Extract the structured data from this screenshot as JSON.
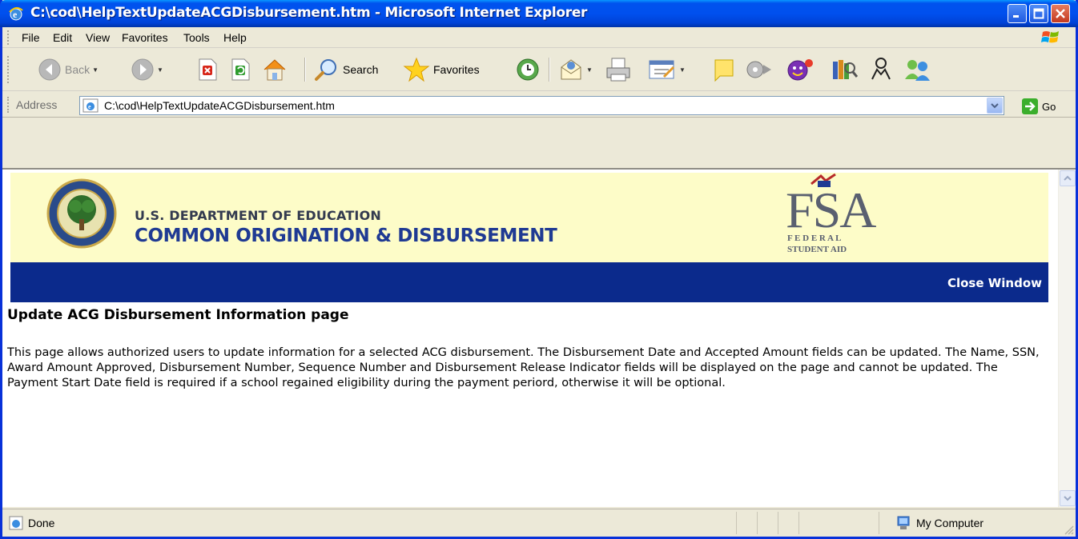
{
  "window": {
    "title": "C:\\cod\\HelpTextUpdateACGDisbursement.htm - Microsoft Internet Explorer"
  },
  "menu": [
    "File",
    "Edit",
    "View",
    "Favorites",
    "Tools",
    "Help"
  ],
  "toolbar": {
    "back_label": "Back",
    "search_label": "Search",
    "favorites_label": "Favorites"
  },
  "address": {
    "label": "Address",
    "value": "C:\\cod\\HelpTextUpdateACGDisbursement.htm",
    "go_label": "Go"
  },
  "page": {
    "dept_line1": "U.S. DEPARTMENT OF EDUCATION",
    "dept_line2": "COMMON ORIGINATION & DISBURSEMENT",
    "fsa_letters": "FSA",
    "fsa_federal": "F E D E R A L",
    "fsa_student_aid": "STUDENT AID",
    "close_window": "Close Window",
    "heading": "Update ACG Disbursement Information page",
    "body": "This page allows authorized users to update information for a selected ACG disbursement. The Disbursement Date and Accepted Amount fields can be updated. The Name, SSN, Award Amount Approved, Disbursement Number, Sequence Number and Disbursement Release Indicator fields will be displayed on the page and cannot be updated. The Payment Start Date field is required if a school regained eligibility during the payment periord, otherwise it will be optional."
  },
  "status": {
    "text": "Done",
    "zone": "My Computer"
  },
  "colors": {
    "titlebar": "#0050ee",
    "banner_bg": "#fdfcc8",
    "navbar_bg": "#0b2a8c",
    "dept_blue": "#1f3a93"
  },
  "icons": [
    "ie-icon",
    "minimize-icon",
    "maximize-icon",
    "close-icon",
    "windows-flag-icon",
    "back-icon",
    "forward-icon",
    "stop-icon",
    "refresh-icon",
    "home-icon",
    "search-icon",
    "favorites-star-icon",
    "history-icon",
    "mail-icon",
    "print-icon",
    "edit-icon",
    "discuss-icon",
    "messenger-icon",
    "research-icon",
    "buddy-icon",
    "go-arrow-icon",
    "computer-icon"
  ]
}
